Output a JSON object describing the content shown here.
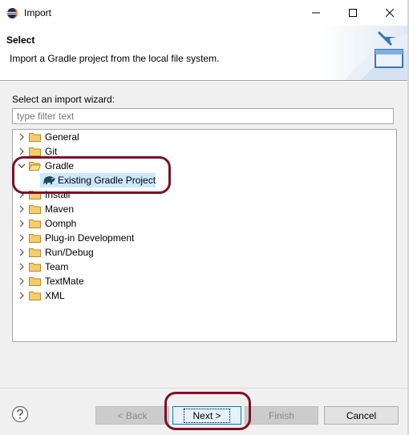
{
  "window": {
    "title": "Import",
    "minimize_icon": "minimize-icon",
    "maximize_icon": "maximize-icon",
    "close_icon": "close-icon"
  },
  "banner": {
    "title": "Select",
    "description": "Import a Gradle project from the local file system.",
    "icon": "import-wizard-icon"
  },
  "wizard": {
    "label": "Select an import wizard:",
    "filter_placeholder": "type filter text",
    "filter_value": "",
    "tree": [
      {
        "label": "General",
        "expanded": false
      },
      {
        "label": "Git",
        "expanded": false
      },
      {
        "label": "Gradle",
        "expanded": true,
        "children": [
          {
            "label": "Existing Gradle Project",
            "selected": true
          }
        ]
      },
      {
        "label": "Install",
        "expanded": false
      },
      {
        "label": "Maven",
        "expanded": false
      },
      {
        "label": "Oomph",
        "expanded": false
      },
      {
        "label": "Plug-in Development",
        "expanded": false
      },
      {
        "label": "Run/Debug",
        "expanded": false
      },
      {
        "label": "Team",
        "expanded": false
      },
      {
        "label": "TextMate",
        "expanded": false
      },
      {
        "label": "XML",
        "expanded": false
      }
    ]
  },
  "footer": {
    "help_icon": "help-icon",
    "back_label": "< Back",
    "next_label": "Next >",
    "finish_label": "Finish",
    "cancel_label": "Cancel"
  },
  "colors": {
    "highlight": "#7b1128",
    "selection": "#cce8ff",
    "folder": "#e8b64a",
    "accent": "#0078d7"
  }
}
